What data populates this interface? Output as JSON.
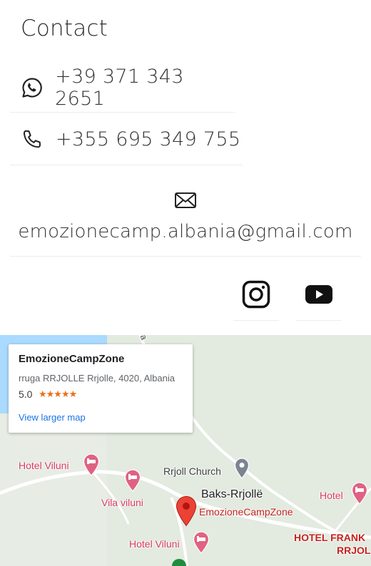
{
  "contact": {
    "title": "Contact",
    "whatsapp": {
      "icon": "whatsapp-icon",
      "number": "+39 371 343 2651"
    },
    "phone": {
      "icon": "phone-icon",
      "number": "+355 695 349 755"
    },
    "email": {
      "icon": "envelope-icon",
      "address": "emozionecamp.albania@gmail.com"
    }
  },
  "social": [
    {
      "name": "instagram",
      "icon": "instagram-icon"
    },
    {
      "name": "youtube",
      "icon": "youtube-icon"
    }
  ],
  "map": {
    "card": {
      "place_name": "EmozioneCampZone",
      "address": "rruga RRJOLLE Rrjolle, 4020, Albania",
      "rating": "5.0",
      "stars": "★★★★★",
      "larger_map_link": "View larger map"
    },
    "labels": {
      "hotel_viluni_1": "Hotel Viluni",
      "vila_viluni": "Vila viluni",
      "rrjoll_church": "Rrjoll Church",
      "baks_rrjolle": "Baks-Rrjollë",
      "marker_name": "EmozioneCampZone",
      "hotel_viluni_2": "Hotel Viluni",
      "hotel_right": "Hotel",
      "hotel_frank": "HOTEL FRANK",
      "rrjol": "RRJOL",
      "road_fragment": "a"
    },
    "colors": {
      "land": "#e7ece4",
      "water": "#aadaff",
      "road": "#ffffff",
      "marker": "#ea4335",
      "hotel_pin": "#e06283",
      "church_pin": "#7b8491",
      "accent_link": "#1a73e8",
      "stars": "#e7711b"
    }
  }
}
